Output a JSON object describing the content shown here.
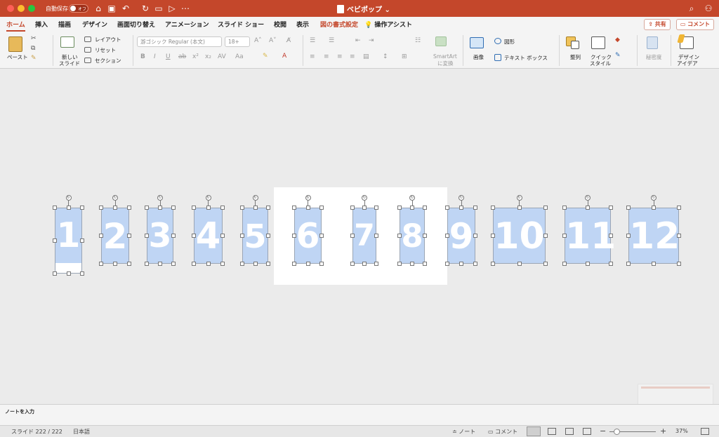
{
  "titlebar": {
    "autosave_label": "自動保存",
    "autosave_state": "オフ",
    "doc_title": "ベビポップ"
  },
  "tabs": [
    "ホーム",
    "挿入",
    "描画",
    "デザイン",
    "画面切り替え",
    "アニメーション",
    "スライド ショー",
    "校閲",
    "表示",
    "図の書式設定",
    "操作アシスト"
  ],
  "share_label": "共有",
  "comment_label": "コメント",
  "ribbon": {
    "paste": "ペースト",
    "new_slide": [
      "新しい",
      "スライド"
    ],
    "layout": "レイアウト",
    "reset": "リセット",
    "section": "セクション",
    "font_name": "游ゴシック Regular (本文)",
    "font_size": "18+",
    "smartart": [
      "SmartArt",
      "に変換"
    ],
    "image": "画像",
    "shape": "図形",
    "textbox": "テキスト ボックス",
    "arrange": "整列",
    "quick_style": [
      "クイック",
      "スタイル"
    ],
    "sensitivity": "秘密度",
    "design_ideas": [
      "デザイン",
      "アイデア"
    ]
  },
  "slide_numbers": [
    "1",
    "2",
    "3",
    "4",
    "5",
    "6",
    "7",
    "8",
    "9",
    "10",
    "11",
    "12"
  ],
  "notes_placeholder": "ノートを入力",
  "status": {
    "slide_info": "スライド 222 / 222",
    "language": "日本語",
    "notes": "ノート",
    "comments": "コメント",
    "zoom": "37%"
  },
  "colors": {
    "accent": "#c4472b",
    "shape_fill": "#bfd5f4"
  }
}
